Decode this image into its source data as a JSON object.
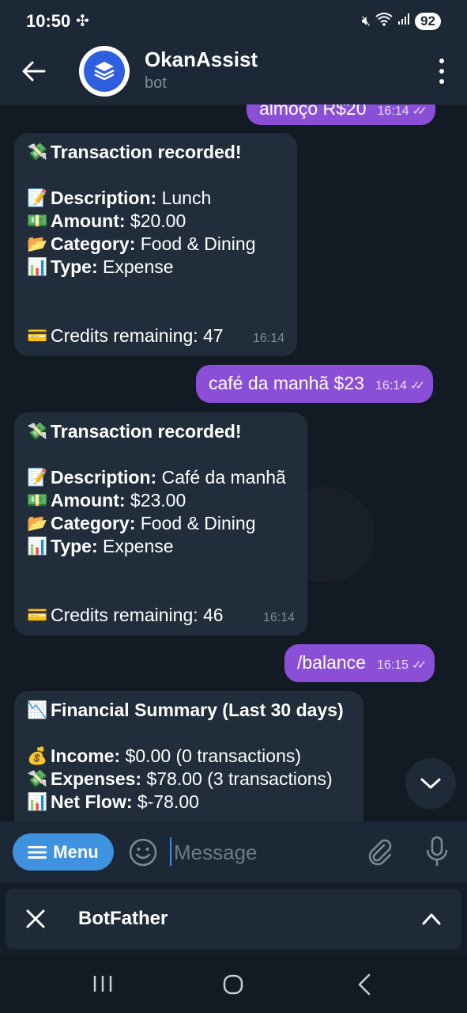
{
  "status_bar": {
    "time": "10:50",
    "battery": "92"
  },
  "header": {
    "title": "OkanAssist",
    "subtitle": "bot"
  },
  "messages": [
    {
      "type": "out",
      "text": "almoço R$20",
      "time": "16:14"
    },
    {
      "type": "in",
      "heading": "Transaction recorded!",
      "description_label": "Description:",
      "description": "Lunch",
      "amount_label": "Amount:",
      "amount": "$20.00",
      "category_label": "Category:",
      "category": "Food & Dining",
      "type_label": "Type:",
      "type_value": "Expense",
      "credits": "Credits remaining: 47",
      "time": "16:14"
    },
    {
      "type": "out",
      "text": "café da manhã $23",
      "time": "16:14"
    },
    {
      "type": "in",
      "heading": "Transaction recorded!",
      "description_label": "Description:",
      "description": "Café da manhã",
      "amount_label": "Amount:",
      "amount": "$23.00",
      "category_label": "Category:",
      "category": "Food & Dining",
      "type_label": "Type:",
      "type_value": "Expense",
      "credits": "Credits remaining: 46",
      "time": "16:14"
    },
    {
      "type": "out",
      "text": "/balance",
      "time": "16:15"
    },
    {
      "type": "in",
      "heading": "Financial Summary (Last 30 days)",
      "income_label": "Income:",
      "income": "$0.00 (0 transactions)",
      "expenses_label": "Expenses:",
      "expenses": "$78.00 (3 transactions)",
      "netflow_label": "Net Flow:",
      "netflow": "$-78.00"
    }
  ],
  "input": {
    "menu_label": "Menu",
    "placeholder": "Message"
  },
  "bot_panel": {
    "label": "BotFather"
  },
  "colors": {
    "outgoing_bubble": "#8a4fd6",
    "incoming_bubble": "#212d3b",
    "accent": "#3e92e0"
  }
}
